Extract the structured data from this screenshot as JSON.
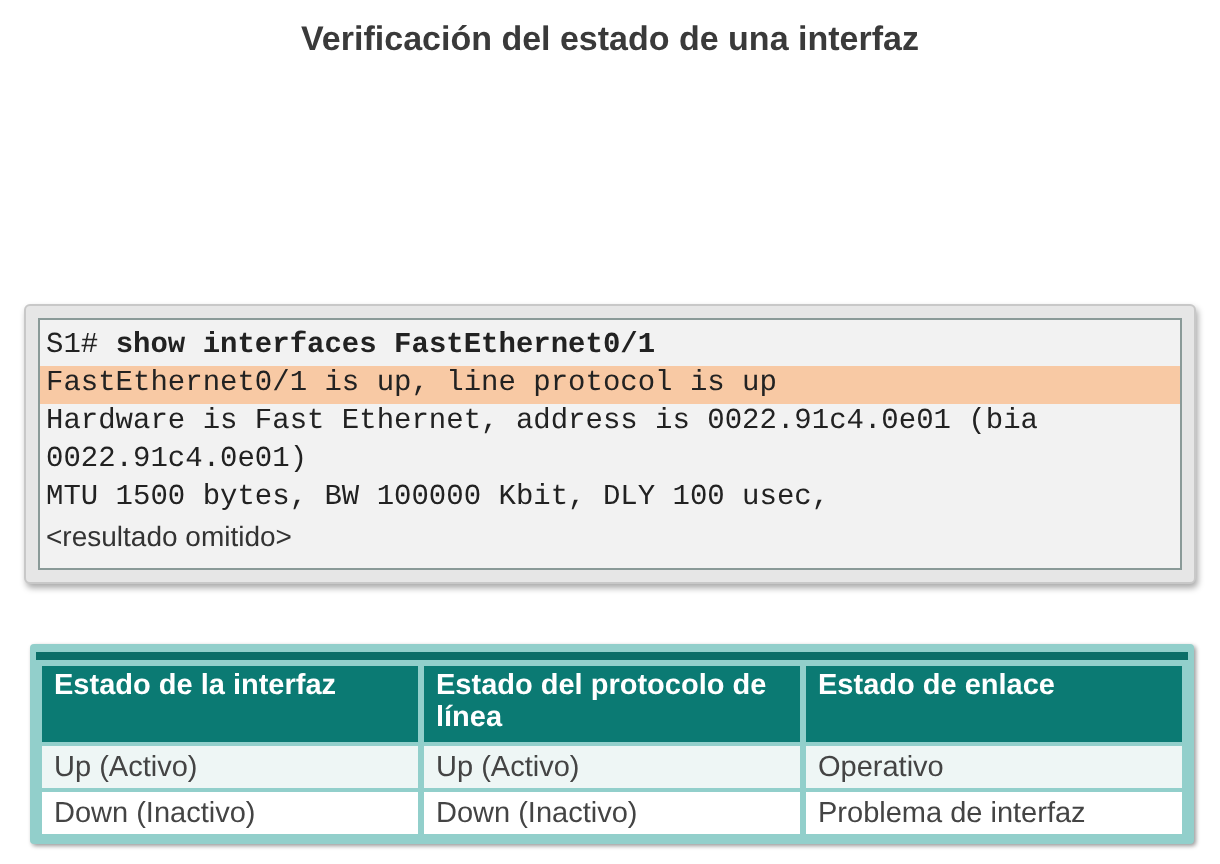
{
  "title": "Verificación del estado de una interfaz",
  "terminal": {
    "lines": [
      {
        "kind": "command",
        "prompt": "S1#",
        "command": "show interfaces FastEthernet0/1",
        "highlighted": false
      },
      {
        "kind": "output",
        "text": "FastEthernet0/1 is up, line protocol is up",
        "highlighted": true
      },
      {
        "kind": "output",
        "text": "Hardware is Fast Ethernet, address is 0022.91c4.0e01 (bia 0022.91c4.0e01)",
        "highlighted": false
      },
      {
        "kind": "output",
        "text": "MTU 1500 bytes, BW 100000 Kbit, DLY 100 usec,",
        "highlighted": false
      },
      {
        "kind": "note",
        "text": "<resultado omitido>",
        "highlighted": false
      }
    ]
  },
  "table": {
    "columns": [
      "Estado de la interfaz",
      "Estado del protocolo de línea",
      "Estado de enlace"
    ],
    "rows": [
      [
        "Up (Activo)",
        "Up (Activo)",
        "Operativo"
      ],
      [
        "Down (Inactivo)",
        "Down (Inactivo)",
        "Problema de interfaz"
      ]
    ]
  }
}
